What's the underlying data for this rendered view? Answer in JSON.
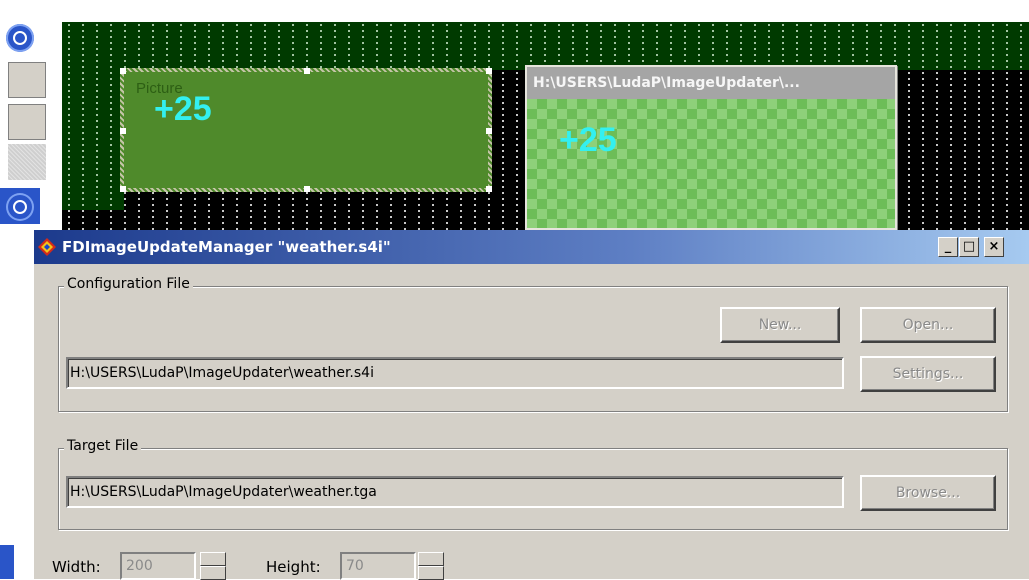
{
  "colors": {
    "canvas_bg": "#000000",
    "canvas_green": "#003a00",
    "picture_fill": "#4f8a2b",
    "value_text": "#33f0f0",
    "title_gradient_start": "#1c3a8c",
    "dialog_bg": "#d4d0c8"
  },
  "sidebar": {
    "icons": [
      "chevron-down-icon",
      "chevron-down-icon"
    ]
  },
  "designer": {
    "picture_label": "Picture",
    "picture_value": "+25"
  },
  "preview": {
    "title": "H:\\USERS\\LudaP\\ImageUpdater\\...",
    "value": "+25"
  },
  "dialog": {
    "title": "FDImageUpdateManager \"weather.s4i\"",
    "controls": {
      "minimize": "_",
      "maximize": "□",
      "close": "×"
    },
    "config": {
      "legend": "Configuration File",
      "new_label": "New...",
      "open_label": "Open...",
      "path": "H:\\USERS\\LudaP\\ImageUpdater\\weather.s4i",
      "settings_label": "Settings..."
    },
    "target": {
      "legend": "Target File",
      "path": "H:\\USERS\\LudaP\\ImageUpdater\\weather.tga",
      "browse_label": "Browse..."
    },
    "width_label": "Width:",
    "width_value": "200",
    "height_label": "Height:",
    "height_value": "70"
  }
}
